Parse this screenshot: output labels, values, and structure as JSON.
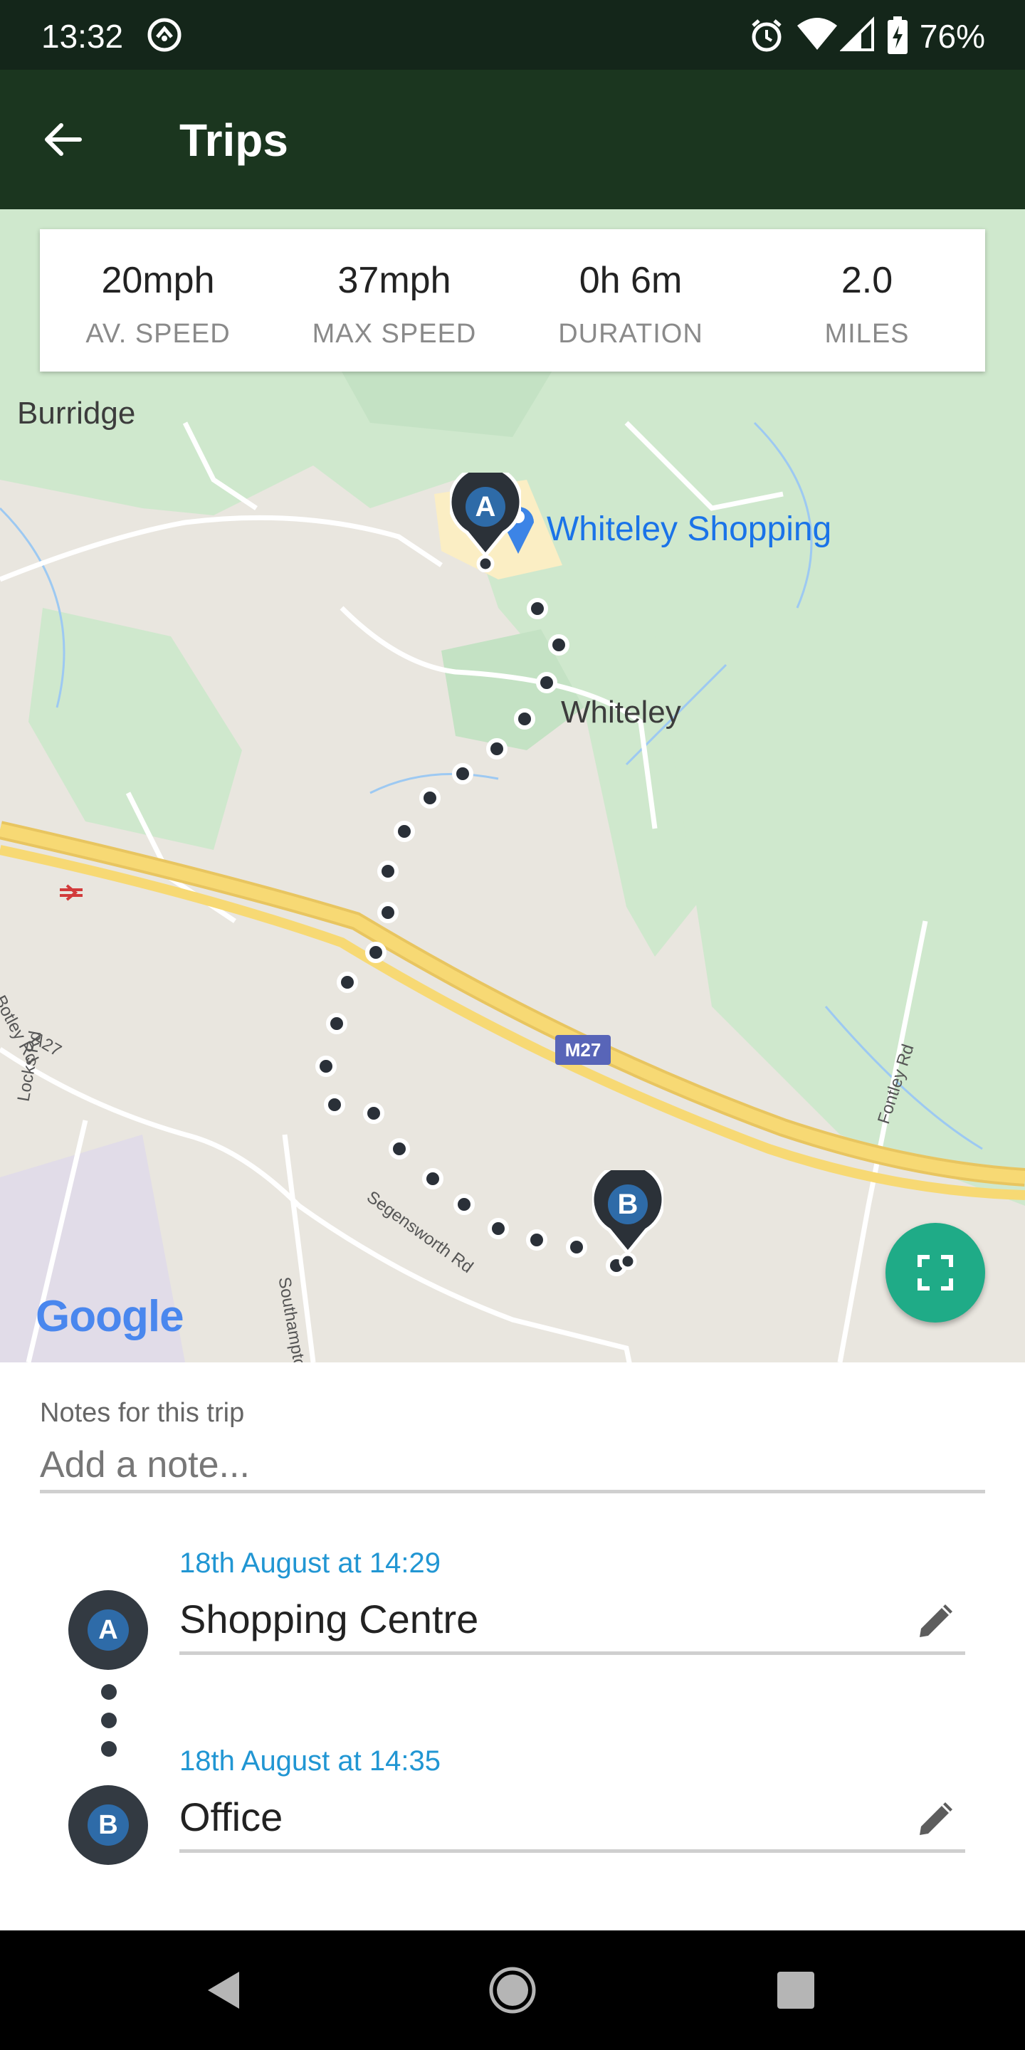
{
  "status_bar": {
    "time": "13:32",
    "battery": "76%",
    "icons": [
      "sync-icon",
      "alarm-icon",
      "wifi-icon",
      "signal-icon",
      "battery-charging-icon"
    ]
  },
  "app_bar": {
    "title": "Trips",
    "back_icon": "arrow-left-icon"
  },
  "stats": [
    {
      "value": "20mph",
      "label": "AV. SPEED"
    },
    {
      "value": "37mph",
      "label": "MAX SPEED"
    },
    {
      "value": "0h 6m",
      "label": "DURATION"
    },
    {
      "value": "2.0",
      "label": "MILES"
    }
  ],
  "map": {
    "labels": {
      "burridge": "Burridge",
      "whiteley_shopping": "Whiteley Shopping",
      "whiteley": "Whiteley",
      "m27": "M27",
      "botley_rd": "Botley Rd",
      "a27": "A27",
      "locks_rd": "Locks Rd",
      "segensworth_rd": "Segensworth Rd",
      "fontley_rd": "Fontley Rd",
      "southampton": "Southampto",
      "google": "Google"
    },
    "start_marker": "A",
    "end_marker": "B",
    "fullscreen_icon": "fullscreen-icon"
  },
  "notes": {
    "label": "Notes for this trip",
    "placeholder": "Add a note..."
  },
  "stops": [
    {
      "marker": "A",
      "time": "18th August at 14:29",
      "name": "Shopping Centre"
    },
    {
      "marker": "B",
      "time": "18th August at 14:35",
      "name": "Office"
    }
  ],
  "colors": {
    "status_bar": "#14261a",
    "app_bar": "#1b361f",
    "accent": "#1fab87",
    "link": "#2196d3",
    "marker": "#333a42"
  }
}
